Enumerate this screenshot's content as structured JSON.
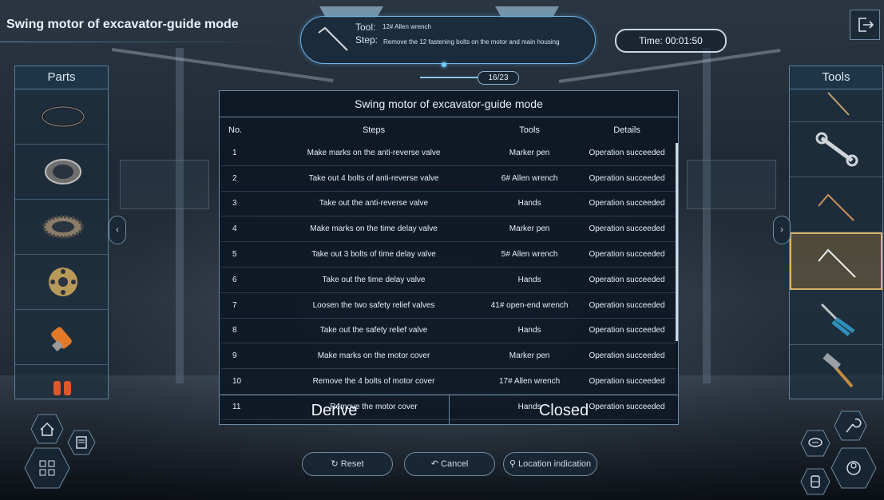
{
  "header": {
    "title": "Swing motor of excavator-guide mode",
    "tool_label": "Tool:",
    "tool_value": "12# Allen wrench",
    "step_label": "Step:",
    "step_value": "Remove the 12 fastening bolts on the motor and main housing",
    "progress": "16/23",
    "timer": "Time: 00:01:50"
  },
  "parts_panel": {
    "title": "Parts",
    "items": [
      "seal-ring",
      "bearing",
      "roller-bearing",
      "valve-plate",
      "orange-plug",
      "orange-caps"
    ]
  },
  "tools_panel": {
    "title": "Tools",
    "items": [
      "wrench-partial",
      "open-end-wrench",
      "allen-wrench",
      "allen-wrench-selected",
      "pliers",
      "hammer"
    ]
  },
  "dialog": {
    "title": "Swing motor of excavator-guide mode",
    "columns": [
      "No.",
      "Steps",
      "Tools",
      "Details"
    ],
    "rows": [
      [
        "1",
        "Make marks on the anti-reverse valve",
        "Marker pen",
        "Operation succeeded"
      ],
      [
        "2",
        "Take out 4 bolts of anti-reverse valve",
        "6# Allen wrench",
        "Operation succeeded"
      ],
      [
        "3",
        "Take out the anti-reverse valve",
        "Hands",
        "Operation succeeded"
      ],
      [
        "4",
        "Make marks on the time delay valve",
        "Marker pen",
        "Operation succeeded"
      ],
      [
        "5",
        "Take out 3 bolts of time delay valve",
        "5# Allen wrench",
        "Operation succeeded"
      ],
      [
        "6",
        "Take out the time delay valve",
        "Hands",
        "Operation succeeded"
      ],
      [
        "7",
        "Loosen the two safety relief valves",
        "41# open-end wrench",
        "Operation succeeded"
      ],
      [
        "8",
        "Take out the safety relief valve",
        "Hands",
        "Operation succeeded"
      ],
      [
        "9",
        "Make marks on the motor cover",
        "Marker pen",
        "Operation succeeded"
      ],
      [
        "10",
        "Remove the 4 bolts of motor cover",
        "17# Allen wrench",
        "Operation succeeded"
      ],
      [
        "11",
        "Remove the motor cover",
        "Hands",
        "Operation succeeded"
      ]
    ],
    "derive_label": "Derive",
    "closed_label": "Closed"
  },
  "bottom": {
    "reset": "Reset",
    "cancel": "Cancel",
    "location": "Location indication"
  },
  "icons": {
    "left_arrow": "‹",
    "right_arrow": "›",
    "reset": "↻",
    "cancel": "↶",
    "location": "⚲"
  }
}
